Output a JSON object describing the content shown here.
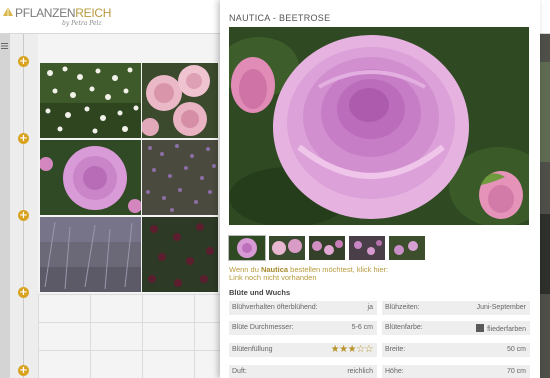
{
  "header": {
    "logo_brand_a": "PFLANZEN",
    "logo_brand_b": "REICH",
    "logo_tagline": "by Petra Pelz"
  },
  "rail": {
    "add_symbol": "+"
  },
  "detail": {
    "title": "NAUTICA - BEETROSE",
    "order_text_before": "Wenn du ",
    "order_product": "Nautica",
    "order_text_after": " bestellen möchtest, klick hier:",
    "order_link": "Link noch nicht vorhanden",
    "section_title": "Blüte und Wuchs",
    "specs_left": [
      {
        "label": "Blühverhalten öfterblühend:",
        "value": "ja"
      },
      {
        "label": "Blüte Durchmesser:",
        "value": "5-6 cm"
      },
      {
        "label": "Blütenfüllung",
        "rating": 3,
        "rating_max": 5
      },
      {
        "label": "Duft:",
        "value": "reichlich"
      }
    ],
    "specs_right": [
      {
        "label": "Blühzeiten:",
        "value": "Juni-September"
      },
      {
        "label": "Blütenfarbe:",
        "value": "fliederfarben",
        "swatch": "#5a5a5a"
      },
      {
        "label": "Breite:",
        "value": "50 cm"
      },
      {
        "label": "Höhe:",
        "value": "70 cm"
      }
    ]
  },
  "colors": {
    "accent_gold": "#d8a320",
    "link_gold": "#b89a3c",
    "rose_pink": "#d79ad6"
  }
}
